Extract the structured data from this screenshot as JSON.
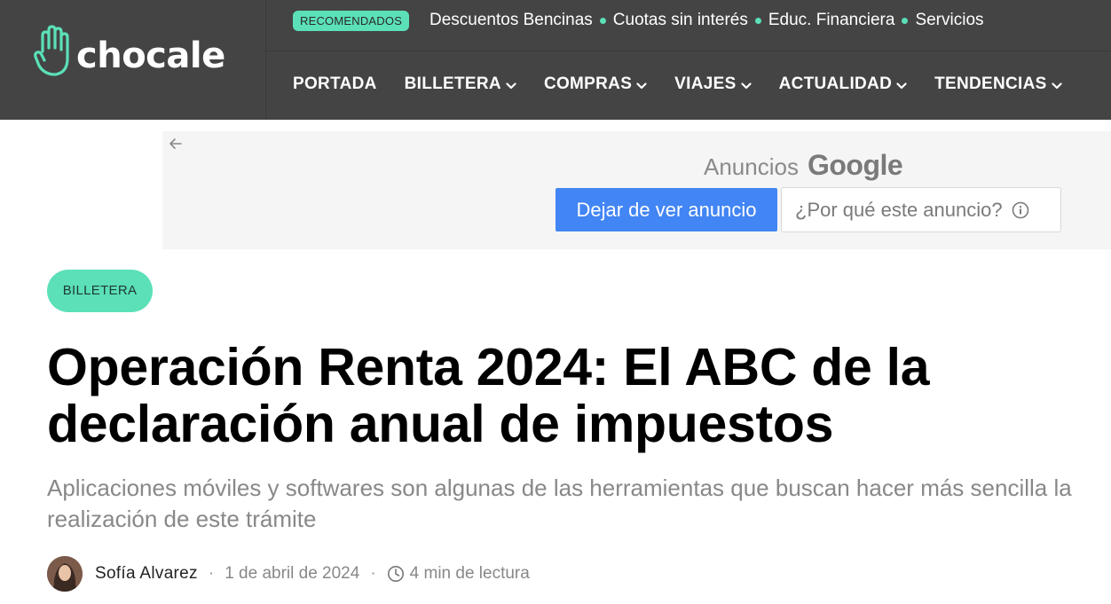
{
  "header": {
    "logo_text": "chocale",
    "recommended_badge": "RECOMENDADOS",
    "top_links": [
      "Descuentos Bencinas",
      "Cuotas sin interés",
      "Educ. Financiera",
      "Servicios"
    ],
    "nav": [
      {
        "label": "PORTADA",
        "has_dropdown": false
      },
      {
        "label": "BILLETERA",
        "has_dropdown": true
      },
      {
        "label": "COMPRAS",
        "has_dropdown": true
      },
      {
        "label": "VIAJES",
        "has_dropdown": true
      },
      {
        "label": "ACTUALIDAD",
        "has_dropdown": true
      },
      {
        "label": "TENDENCIAS",
        "has_dropdown": true
      }
    ]
  },
  "ad": {
    "title_prefix": "Anuncios",
    "title_brand": "Google",
    "stop_button": "Dejar de ver anuncio",
    "why_button": "¿Por qué este anuncio?"
  },
  "article": {
    "category": "BILLETERA",
    "title": "Operación Renta 2024: El ABC de la declaración anual de impuestos",
    "subtitle": "Aplicaciones móviles y softwares son algunas de las herramientas que buscan hacer más sencilla la realización de este trámite",
    "author": "Sofía Alvarez",
    "date": "1 de abril de 2024",
    "read_time": "4 min de lectura"
  },
  "colors": {
    "header_bg": "#444444",
    "accent_mint": "#5be0b8",
    "ad_blue": "#4285f4"
  }
}
